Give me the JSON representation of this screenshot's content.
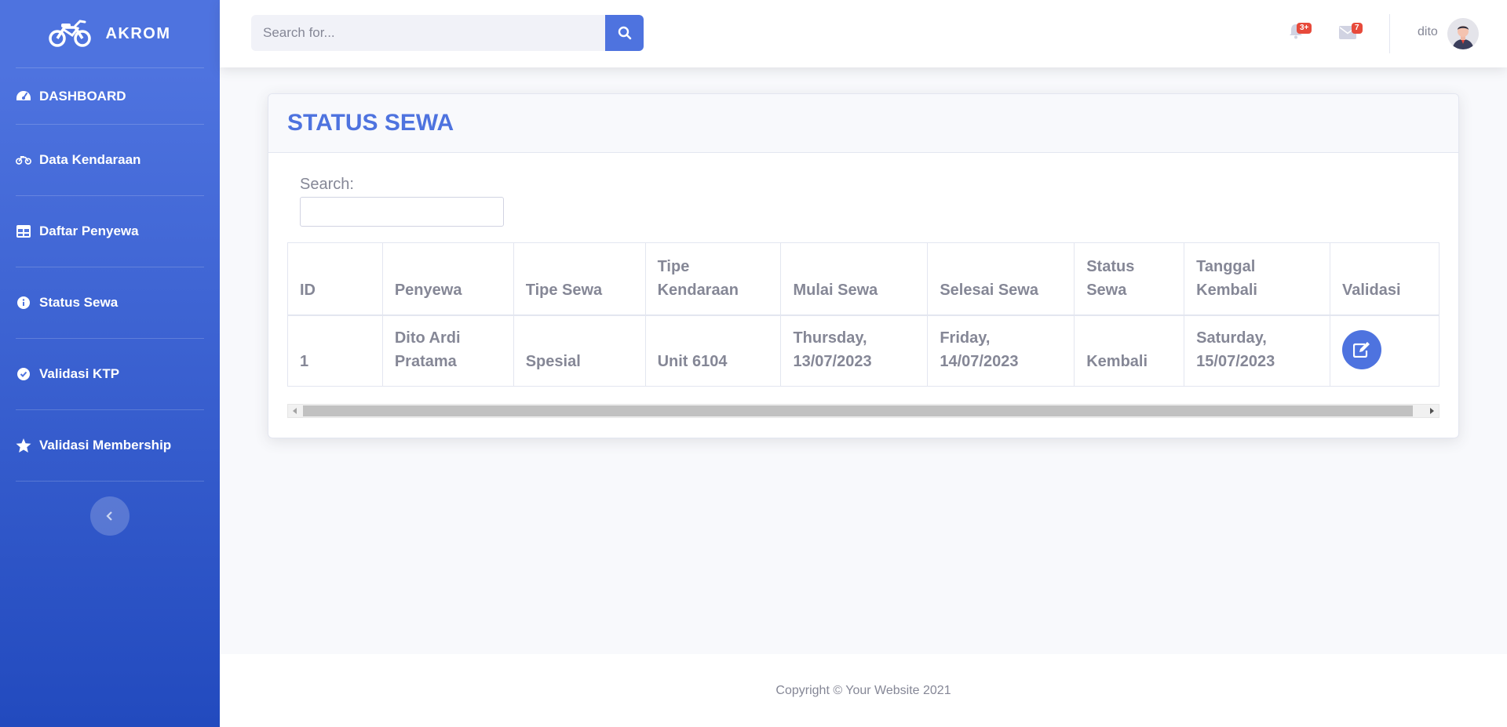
{
  "brand": {
    "name": "AKROM",
    "icon": "motorcycle-icon"
  },
  "sidebar": {
    "items": [
      {
        "label": "DASHBOARD",
        "icon": "tachometer-icon"
      },
      {
        "label": "Data Kendaraan",
        "icon": "motorcycle-icon"
      },
      {
        "label": "Daftar Penyewa",
        "icon": "table-icon"
      },
      {
        "label": "Status Sewa",
        "icon": "info-circle-icon"
      },
      {
        "label": "Validasi KTP",
        "icon": "check-circle-icon"
      },
      {
        "label": "Validasi Membership",
        "icon": "star-icon"
      }
    ],
    "toggle_icon": "chevron-left-icon"
  },
  "topbar": {
    "search_placeholder": "Search for...",
    "alerts_badge": "3+",
    "messages_badge": "7",
    "user_name": "dito"
  },
  "card": {
    "title": "STATUS SEWA",
    "search_label": "Search:",
    "table": {
      "columns": [
        "ID",
        "Penyewa",
        "Tipe Sewa",
        "Tipe Kendaraan",
        "Mulai Sewa",
        "Selesai Sewa",
        "Status Sewa",
        "Tanggal Kembali",
        "Validasi"
      ],
      "rows": [
        {
          "id": "1",
          "penyewa": "Dito Ardi Pratama",
          "tipe_sewa": "Spesial",
          "tipe_kendaraan": "Unit 6104",
          "mulai_sewa": "Thursday, 13/07/2023",
          "selesai_sewa": "Friday, 14/07/2023",
          "status_sewa": "Kembali",
          "tanggal_kembali": "Saturday, 15/07/2023",
          "validasi_icon": "edit-icon"
        }
      ]
    }
  },
  "footer": {
    "copyright": "Copyright © Your Website 2021"
  },
  "colors": {
    "primary": "#4e73df",
    "primary_dark": "#224abe",
    "text_muted": "#858796",
    "badge": "#e74a3b"
  }
}
